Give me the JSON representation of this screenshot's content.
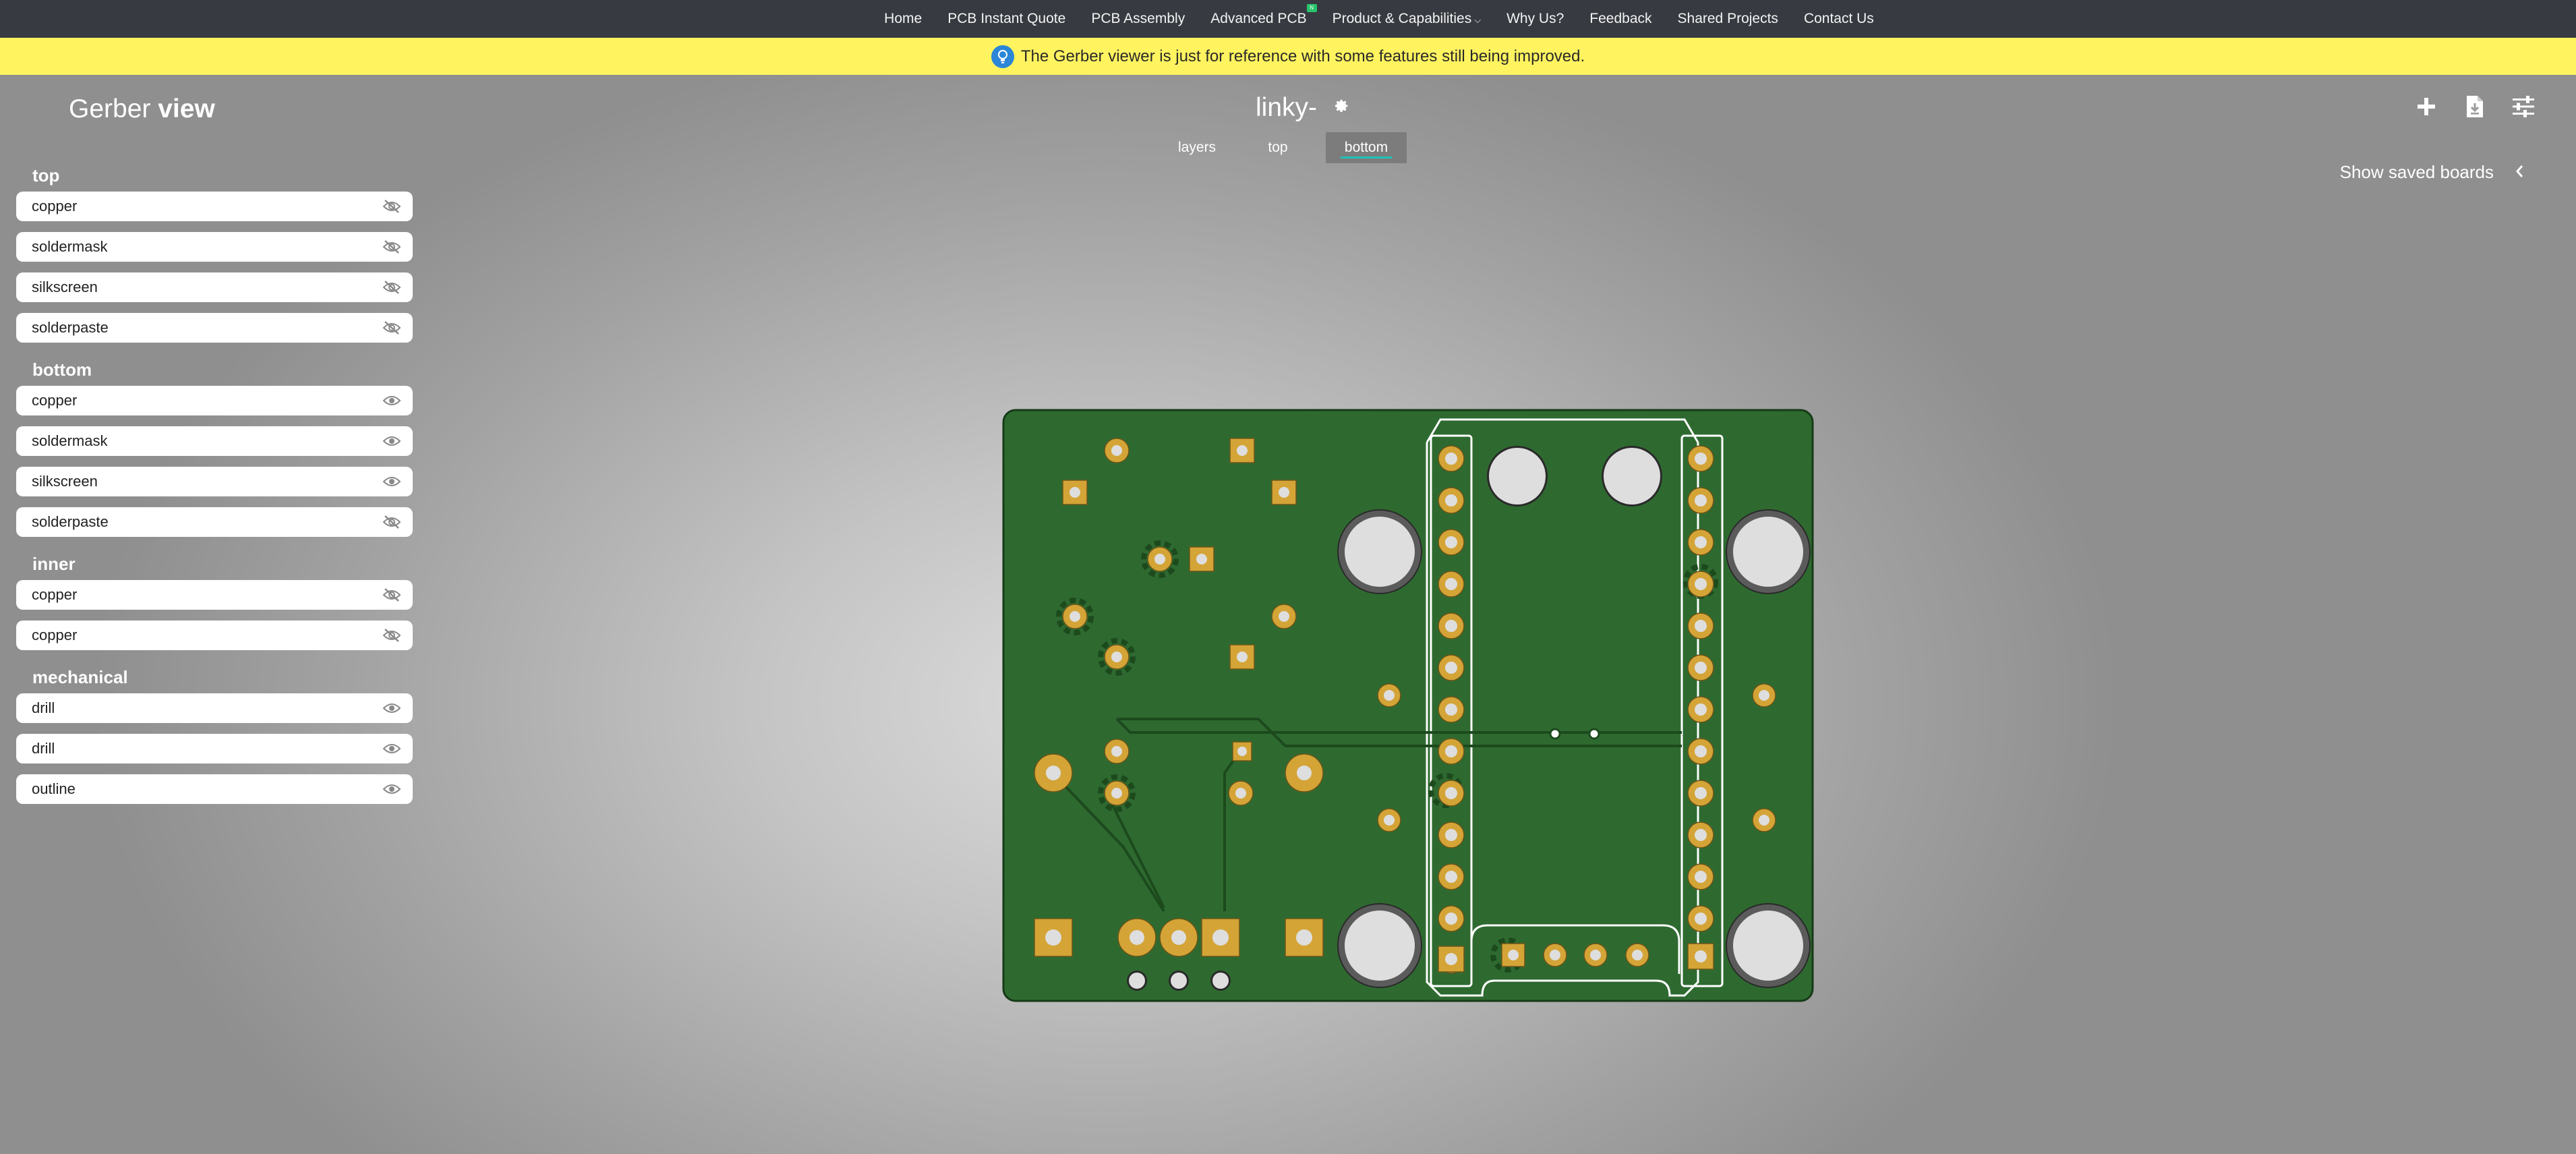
{
  "nav": {
    "items": [
      {
        "label": "Home"
      },
      {
        "label": "PCB Instant Quote"
      },
      {
        "label": "PCB Assembly"
      },
      {
        "label": "Advanced PCB",
        "badge": "N"
      },
      {
        "label": "Product & Capabilities",
        "caret": "⌵"
      },
      {
        "label": "Why Us?"
      },
      {
        "label": "Feedback"
      },
      {
        "label": "Shared Projects"
      },
      {
        "label": "Contact Us"
      }
    ]
  },
  "notice": {
    "text": "The Gerber viewer is just for reference with some features still being improved.",
    "icon": "lightbulb-icon"
  },
  "header": {
    "title_prefix": "Gerber",
    "title_bold": "view",
    "board_name": "linky-",
    "tabs": [
      {
        "label": "layers",
        "active": false
      },
      {
        "label": "top",
        "active": false
      },
      {
        "label": "bottom",
        "active": true
      }
    ],
    "toolbar": [
      "plus-icon",
      "download-file-icon",
      "sliders-icon"
    ],
    "saved_boards_label": "Show saved boards"
  },
  "layers": {
    "groups": [
      {
        "title": "top",
        "items": [
          {
            "label": "copper",
            "visible": false
          },
          {
            "label": "soldermask",
            "visible": false
          },
          {
            "label": "silkscreen",
            "visible": false
          },
          {
            "label": "solderpaste",
            "visible": false
          }
        ]
      },
      {
        "title": "bottom",
        "items": [
          {
            "label": "copper",
            "visible": true
          },
          {
            "label": "soldermask",
            "visible": true
          },
          {
            "label": "silkscreen",
            "visible": true
          },
          {
            "label": "solderpaste",
            "visible": false
          }
        ]
      },
      {
        "title": "inner",
        "items": [
          {
            "label": "copper",
            "visible": false
          },
          {
            "label": "copper",
            "visible": false
          }
        ]
      },
      {
        "title": "mechanical",
        "items": [
          {
            "label": "drill",
            "visible": true
          },
          {
            "label": "drill",
            "visible": true
          },
          {
            "label": "outline",
            "visible": true
          }
        ]
      }
    ]
  },
  "colors": {
    "board": "#2e6a30",
    "copper": "#d4a437",
    "drill": "#dedede",
    "silkscreen": "#ffffff",
    "notice_bg": "#fff35f",
    "nav_bg": "#373b41",
    "tab_underline": "#1ec3b6"
  }
}
